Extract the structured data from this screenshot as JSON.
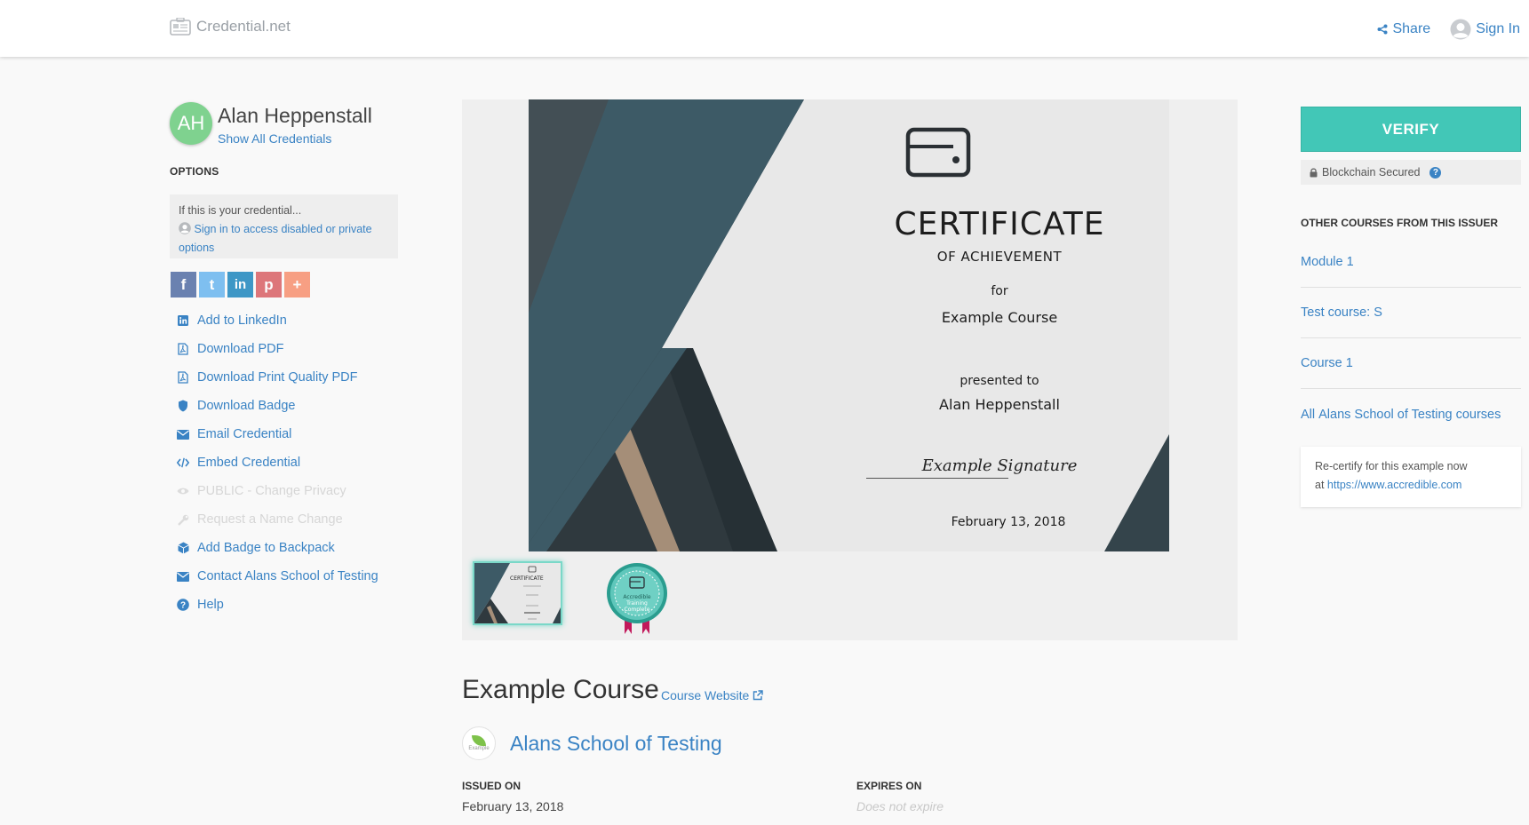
{
  "header": {
    "brand": "Credential.net",
    "share_label": "Share",
    "signin_label": "Sign In"
  },
  "profile": {
    "initials": "AH",
    "name": "Alan Heppenstall",
    "show_all": "Show All Credentials"
  },
  "options": {
    "title": "OPTIONS",
    "notice_line1": "If this is your credential...",
    "notice_link": "Sign in to access disabled or private options",
    "social": [
      {
        "label": "f",
        "color": "#3b5998"
      },
      {
        "label": "t",
        "color": "#55acee"
      },
      {
        "label": "in",
        "color": "#0077b5"
      },
      {
        "label": "p",
        "color": "#cb2027"
      },
      {
        "label": "+",
        "color": "#f77a52"
      }
    ],
    "menu": [
      {
        "label": "Add to LinkedIn",
        "icon": "linkedin-icon",
        "enabled": true
      },
      {
        "label": "Download PDF",
        "icon": "pdf-icon",
        "enabled": true
      },
      {
        "label": "Download Print Quality PDF",
        "icon": "pdf-icon",
        "enabled": true
      },
      {
        "label": "Download Badge",
        "icon": "shield-icon",
        "enabled": true
      },
      {
        "label": "Email Credential",
        "icon": "envelope-icon",
        "enabled": true
      },
      {
        "label": "Embed Credential",
        "icon": "code-icon",
        "enabled": true
      },
      {
        "label": "PUBLIC - Change Privacy",
        "icon": "eye-icon",
        "enabled": false
      },
      {
        "label": "Request a Name Change",
        "icon": "wrench-icon",
        "enabled": false
      },
      {
        "label": "Add Badge to Backpack",
        "icon": "cube-icon",
        "enabled": true
      },
      {
        "label": "Contact Alans School of Testing",
        "icon": "envelope-icon",
        "enabled": true
      },
      {
        "label": "Help",
        "icon": "question-icon",
        "enabled": true
      }
    ]
  },
  "certificate": {
    "title": "CERTIFICATE",
    "subtitle": "OF ACHIEVEMENT",
    "for": "for",
    "course": "Example Course",
    "presented": "presented to",
    "recipient": "Alan Heppenstall",
    "signature": "Example Signature",
    "date": "February 13, 2018",
    "thumb_title": "CERTIFICATE",
    "badge_lines": [
      "Accredible",
      "Training",
      "Complete"
    ]
  },
  "course": {
    "title": "Example Course",
    "website_label": "Course Website",
    "issuer_logo_text": "Example",
    "issuer": "Alans School of Testing",
    "issued_label": "ISSUED ON",
    "issued_value": "February 13, 2018",
    "expires_label": "EXPIRES ON",
    "expires_value": "Does not expire"
  },
  "sidebar_right": {
    "verify_label": "VERIFY",
    "secured_label": "Blockchain Secured",
    "other_title": "OTHER COURSES FROM THIS ISSUER",
    "courses": [
      "Module 1",
      "Test course: S",
      "Course 1"
    ],
    "all_prefix": "All",
    "all_issuer": "Alans School of Testing",
    "all_suffix": "courses",
    "recert_text": "Re-certify for this example now",
    "recert_at": "at",
    "recert_link": "https://www.accredible.com"
  },
  "colors": {
    "accent": "#3a83c4",
    "verify": "#42c7b7",
    "avatar": "#7fd28f",
    "cert_dark": "#2f3a40",
    "cert_teal": "#3d5a66",
    "cert_gold": "#a58e78"
  }
}
